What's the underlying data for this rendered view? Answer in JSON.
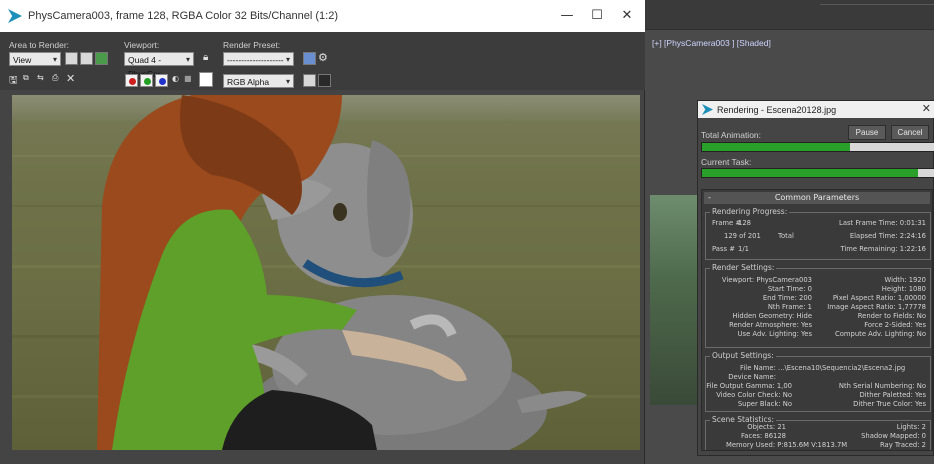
{
  "framebuffer": {
    "title": "PhysCamera003, frame 128, RGBA Color 32 Bits/Channel (1:2)",
    "win_min": "—",
    "win_max": "☐",
    "win_close": "✕",
    "area_to_render_label": "Area to Render:",
    "area_to_render_value": "View",
    "viewport_label": "Viewport:",
    "viewport_value": "Quad 4 - PhysCar",
    "render_preset_label": "Render Preset:",
    "render_preset_value": "--------------------",
    "channel_value": "RGB Alpha",
    "icons": [
      "save-icon",
      "copy-icon",
      "clone-icon",
      "lock-icon",
      "teapot-icon",
      "gear-icon",
      "clear-icon"
    ],
    "channel_colors": [
      "#cc1f1f",
      "#21a021",
      "#2233cc"
    ]
  },
  "viewport": {
    "label": "[+] [PhysCamera003 ] [Shaded]"
  },
  "rendering": {
    "title": "Rendering - Escena20128.jpg",
    "close": "✕",
    "total_animation_label": "Total Animation:",
    "total_animation_progress": 0.64,
    "current_task_label": "Current Task:",
    "current_task_progress": 0.93,
    "pause_label": "Pause",
    "cancel_label": "Cancel",
    "common_parameters": "Common Parameters",
    "progress_group": {
      "label": "Rendering Progress:",
      "frame_label": "Frame #",
      "frame_value": "128",
      "count": "129 of 201",
      "total": "Total",
      "pass_label": "Pass #",
      "pass_value": "1/1",
      "last_frame_time": "Last Frame Time: 0:01:31",
      "elapsed_time": "Elapsed Time: 2:24:16",
      "time_remaining": "Time Remaining: 1:22:16"
    },
    "settings_group": {
      "label": "Render Settings:",
      "left": [
        "Viewport: PhysCamera003",
        "Start Time: 0",
        "End Time: 200",
        "Nth Frame: 1",
        "Hidden Geometry: Hide",
        "Render Atmosphere: Yes",
        "Use Adv. Lighting: Yes"
      ],
      "right": [
        "Width: 1920",
        "Height: 1080",
        "Pixel Aspect Ratio: 1,00000",
        "Image Aspect Ratio: 1,77778",
        "Render to Fields: No",
        "Force 2-Sided: Yes",
        "Compute Adv. Lighting: No"
      ]
    },
    "output_group": {
      "label": "Output Settings:",
      "file_name": "File Name: ...\\Escena10\\Sequencia2\\Escena2.jpg",
      "device_name": "Device Name:",
      "left": [
        "File Output Gamma: 1,00",
        "Video Color Check: No",
        "Super Black: No"
      ],
      "right": [
        "Nth Serial Numbering: No",
        "Dither Paletted: Yes",
        "Dither True Color: Yes"
      ]
    },
    "stats_group": {
      "label": "Scene Statistics:",
      "objects": "Objects: 21",
      "lights": "Lights: 2",
      "faces": "Faces: 86128",
      "shadow_mapped": "Shadow Mapped: 0",
      "memory": "Memory Used: P:815.6M V:1813.7M",
      "ray_traced": "Ray Traced: 2"
    }
  }
}
